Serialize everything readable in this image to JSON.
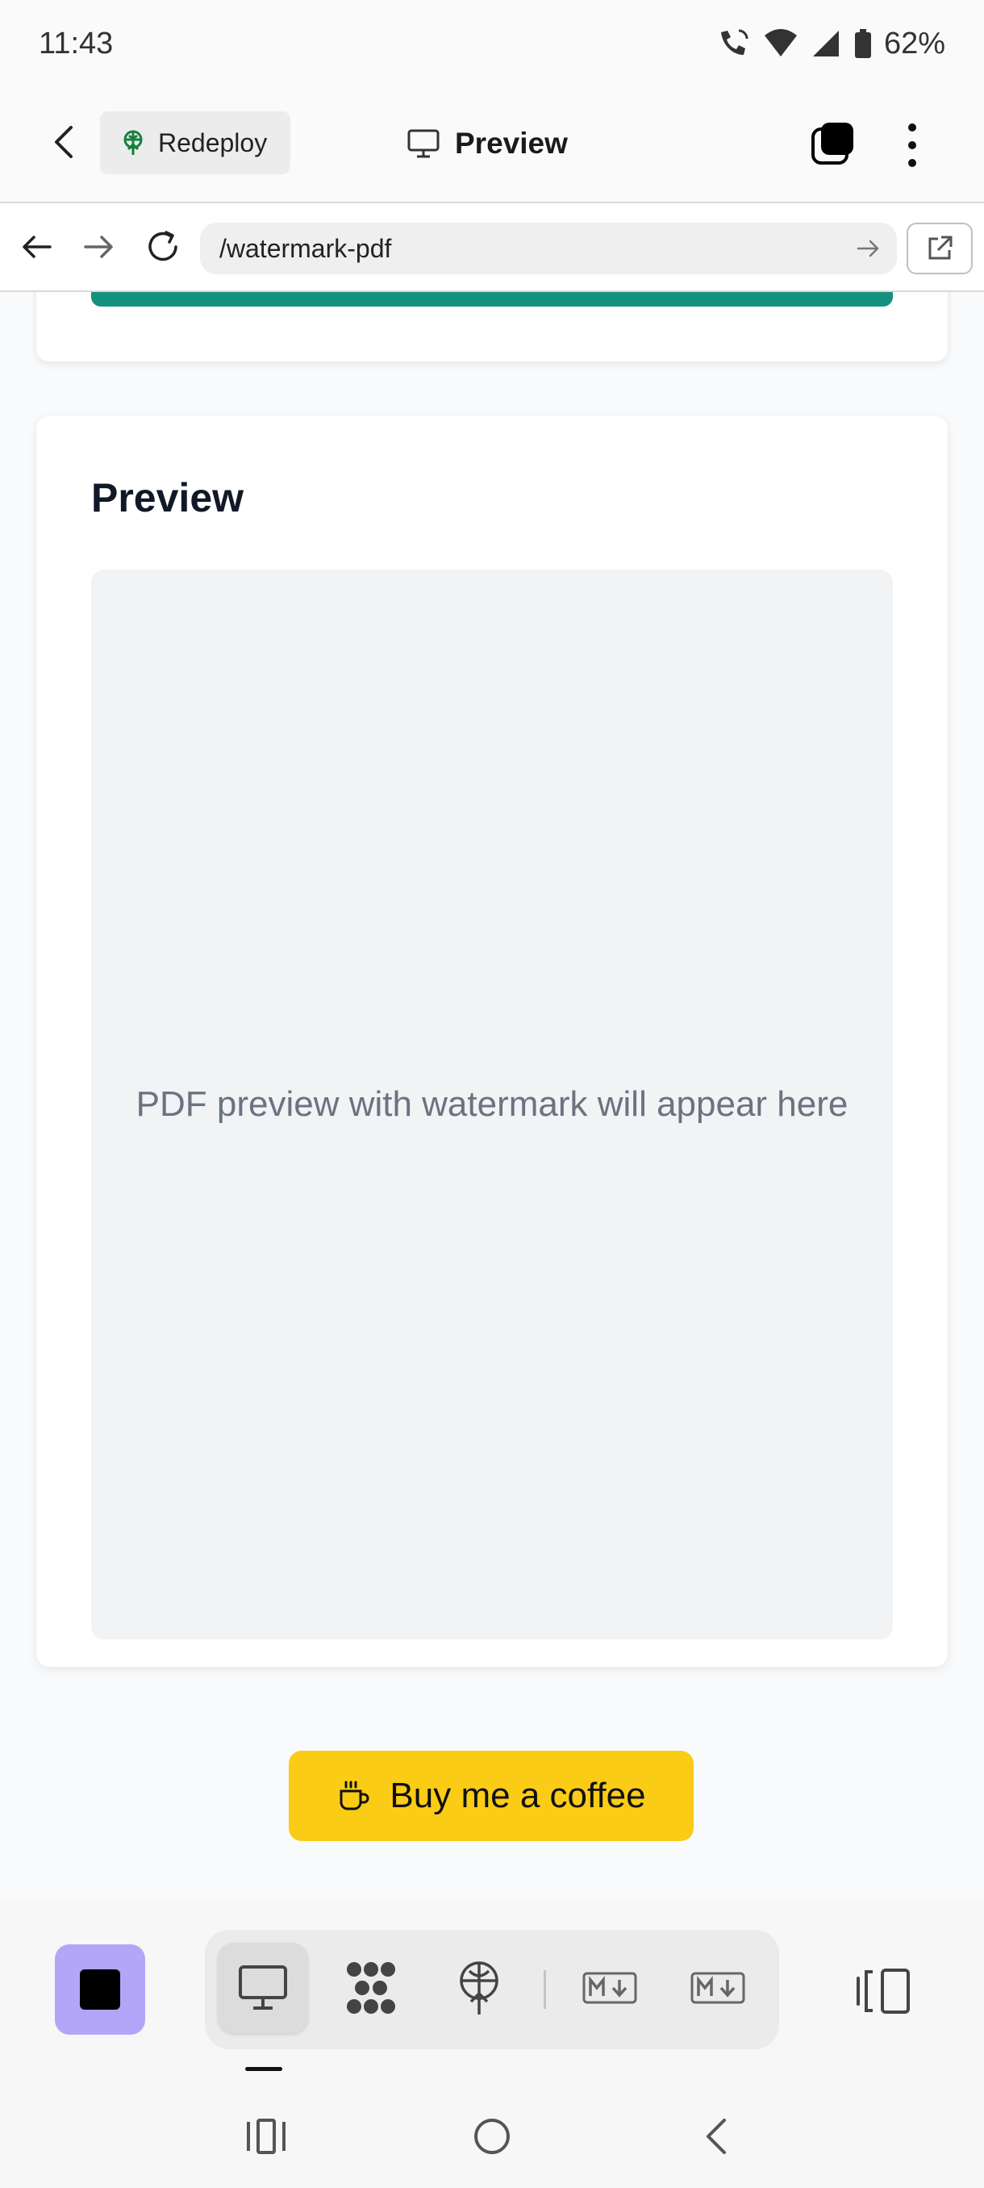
{
  "status_bar": {
    "time": "11:43",
    "battery": "62%"
  },
  "app_bar": {
    "back_label": "Back",
    "redeploy_label": "Redeploy",
    "title": "Preview"
  },
  "url_bar": {
    "url": "/watermark-pdf"
  },
  "page": {
    "section_title": "Preview",
    "placeholder": "PDF preview with watermark will appear here",
    "coffee_button": "Buy me a coffee",
    "teal_color": "#14917f",
    "coffee_color": "#facc15"
  },
  "bottom_toolbar": {
    "tools": [
      "desktop-preview",
      "network",
      "deploy",
      "markdown",
      "markdown"
    ],
    "active_tool": "desktop-preview",
    "stop_color": "#b3a6f8"
  }
}
